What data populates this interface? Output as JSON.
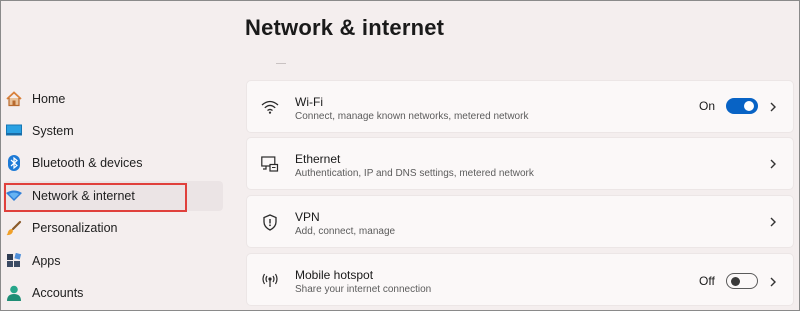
{
  "window": {
    "page_title": "Network & internet"
  },
  "sidebar": {
    "items": [
      {
        "label": "Home",
        "icon": "home-icon"
      },
      {
        "label": "System",
        "icon": "monitor-icon"
      },
      {
        "label": "Bluetooth & devices",
        "icon": "bluetooth-icon"
      },
      {
        "label": "Network & internet",
        "icon": "wifi-diamond-icon",
        "selected": true
      },
      {
        "label": "Personalization",
        "icon": "brush-icon"
      },
      {
        "label": "Apps",
        "icon": "apps-icon"
      },
      {
        "label": "Accounts",
        "icon": "person-icon"
      }
    ]
  },
  "cards": [
    {
      "title": "Wi-Fi",
      "subtitle": "Connect, manage known networks, metered network",
      "icon": "wifi-icon",
      "toggle_label": "On",
      "toggle_on": true
    },
    {
      "title": "Ethernet",
      "subtitle": "Authentication, IP and DNS settings, metered network",
      "icon": "ethernet-icon"
    },
    {
      "title": "VPN",
      "subtitle": "Add, connect, manage",
      "icon": "shield-icon"
    },
    {
      "title": "Mobile hotspot",
      "subtitle": "Share your internet connection",
      "icon": "hotspot-icon",
      "toggle_label": "Off",
      "toggle_on": false
    }
  ],
  "colors": {
    "accent": "#0863c5",
    "highlight": "#e0403c",
    "background": "#f4eeee",
    "card": "#fbf8f8"
  }
}
